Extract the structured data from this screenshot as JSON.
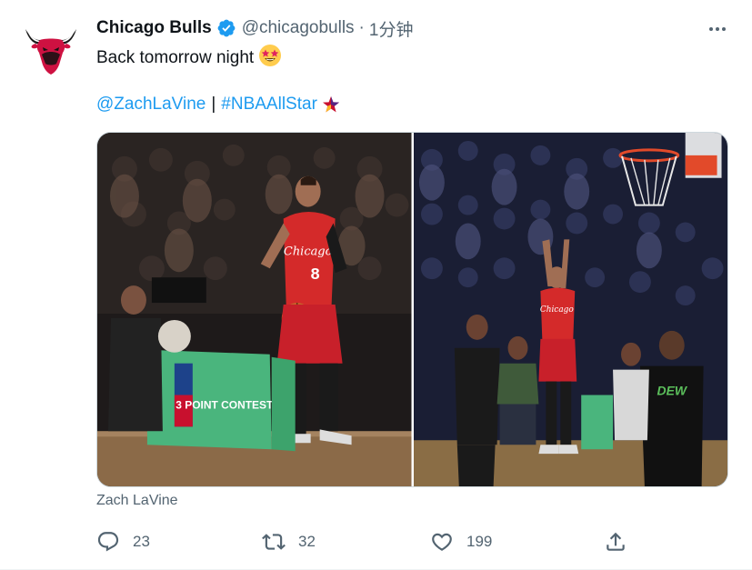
{
  "account": {
    "name": "Chicago Bulls",
    "handle": "@chicagobulls",
    "separator": "·",
    "time": "1分钟",
    "avatar_icon": "bull-logo-icon",
    "verified_icon": "verified-badge-icon",
    "verified_color": "#1d9bf0"
  },
  "tweet": {
    "text": "Back tomorrow night",
    "emoji_icon": "star-struck-emoji-icon",
    "mention": "@ZachLaVine",
    "divider": "|",
    "hashtag": "#NBAAllStar",
    "hashtag_emoji_icon": "all-star-icon"
  },
  "media": {
    "photos": [
      {
        "icon": "photo-lavine-3pt-contest"
      },
      {
        "icon": "photo-lavine-celebrating"
      }
    ],
    "signage_text": "3 POINT CONTEST"
  },
  "tagged_user": "Zach LaVine",
  "actions": {
    "reply": {
      "icon": "reply-icon",
      "count": "23"
    },
    "retweet": {
      "icon": "retweet-icon",
      "count": "32"
    },
    "like": {
      "icon": "heart-icon",
      "count": "199"
    },
    "share": {
      "icon": "share-icon"
    }
  },
  "colors": {
    "link": "#1d9bf0",
    "secondary_text": "#536471",
    "bulls_red": "#ce1141"
  }
}
